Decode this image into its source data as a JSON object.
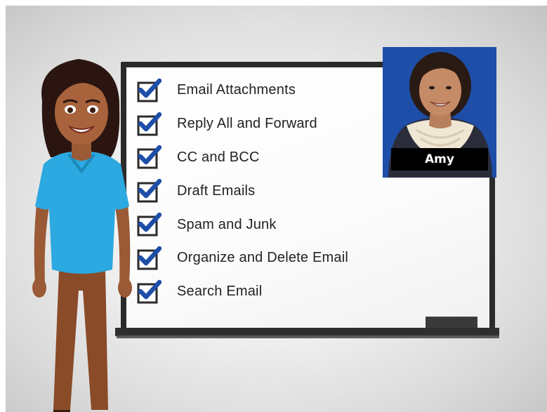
{
  "checklist": {
    "items": [
      {
        "label": "Email Attachments",
        "checked": true
      },
      {
        "label": "Reply All and Forward",
        "checked": true
      },
      {
        "label": "CC and BCC",
        "checked": true
      },
      {
        "label": "Draft Emails",
        "checked": true
      },
      {
        "label": "Spam and Junk",
        "checked": true
      },
      {
        "label": "Organize and Delete Email",
        "checked": true
      },
      {
        "label": "Search Email",
        "checked": true
      }
    ]
  },
  "webcam": {
    "name": "Amy"
  },
  "colors": {
    "check_accent": "#1e4ea8",
    "webcam_bg": "#1e4ea8",
    "shirt": "#2ba9e0",
    "board_frame": "#2b2b2b"
  }
}
